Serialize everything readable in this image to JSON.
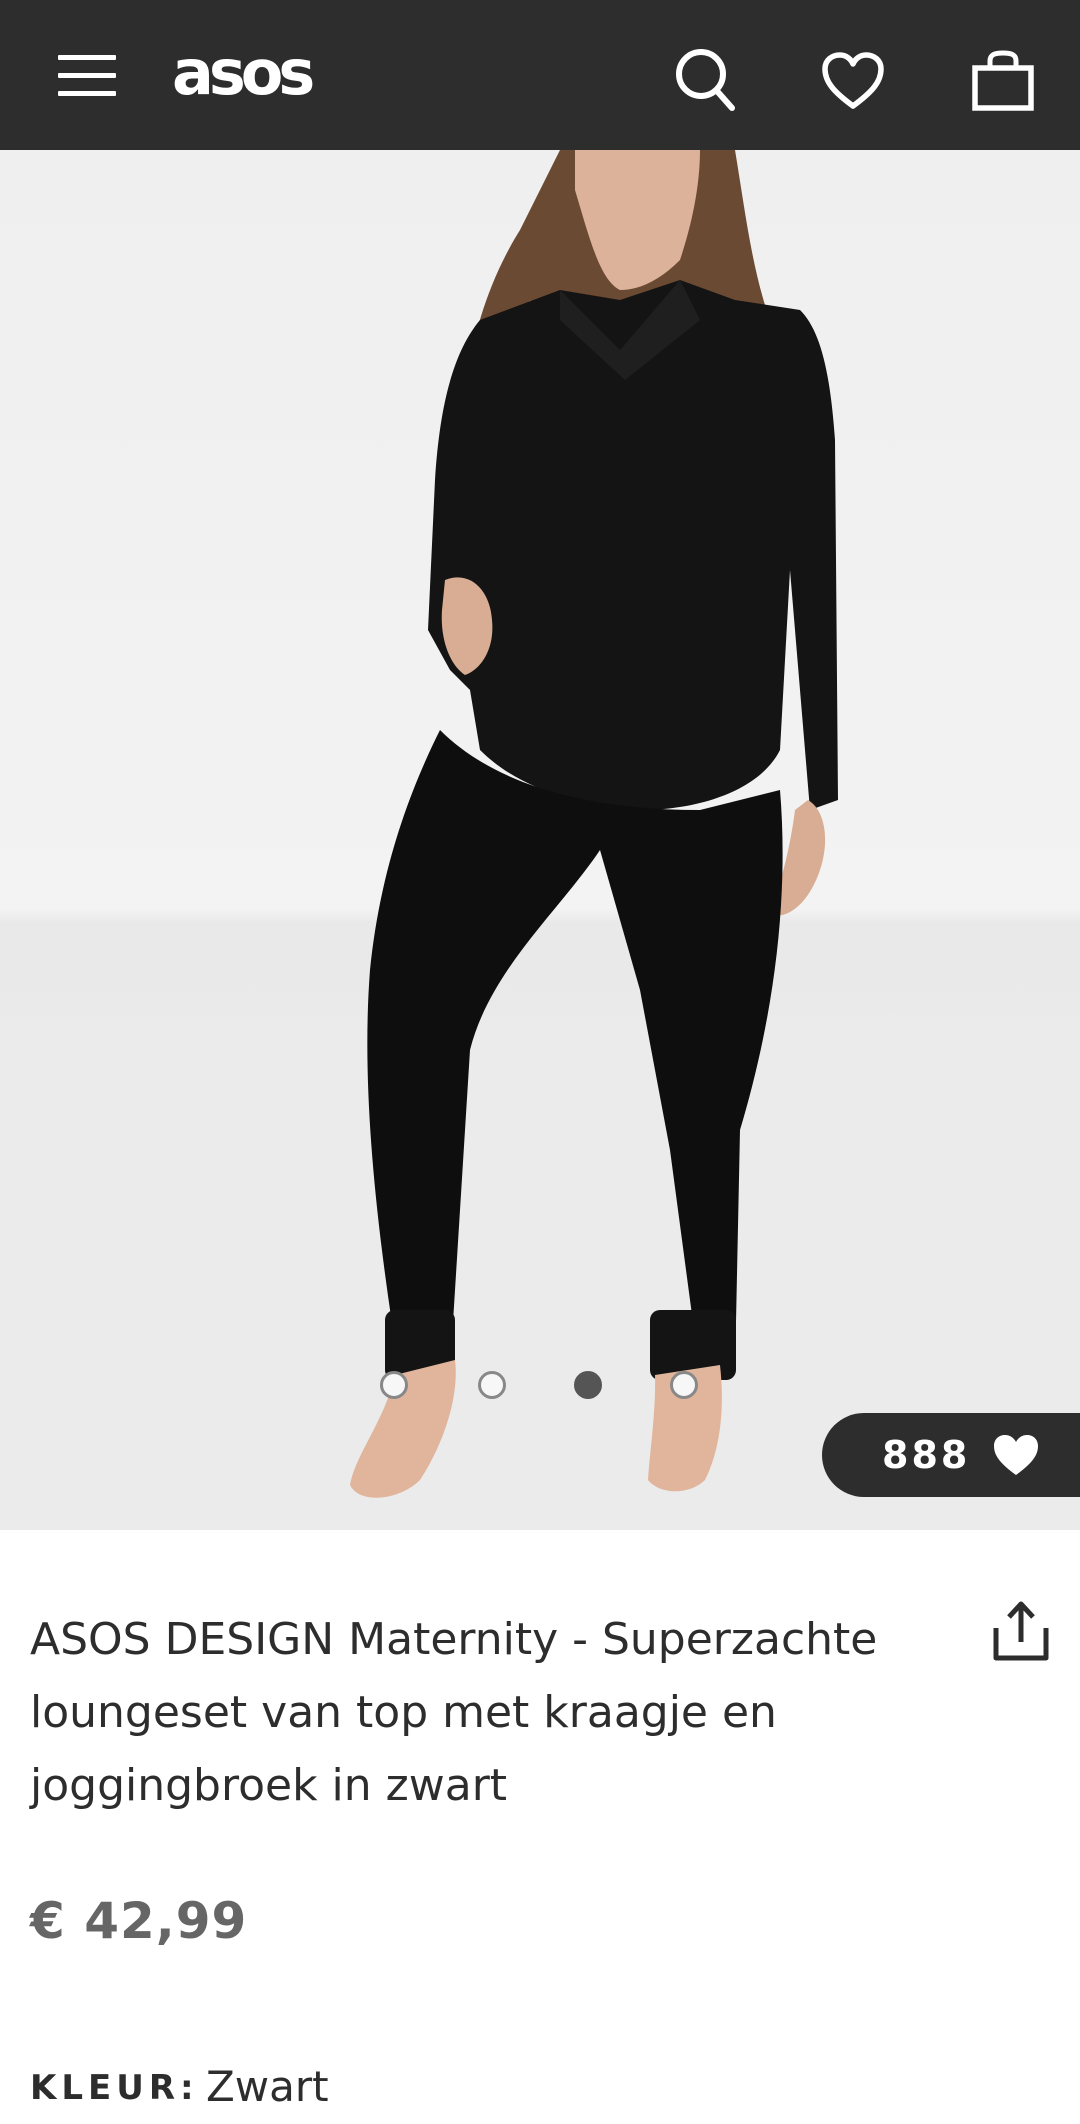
{
  "header": {
    "logo": "asos",
    "menu_icon": "hamburger-menu-icon",
    "search_icon": "search-icon",
    "wishlist_icon": "heart-icon",
    "bag_icon": "shopping-bag-icon",
    "background": "#2d2d2d"
  },
  "gallery": {
    "dots": [
      "empty",
      "empty",
      "active",
      "empty"
    ],
    "saves_count": "888",
    "saves_icon": "heart-icon"
  },
  "product": {
    "title": "ASOS DESIGN Maternity - Superzachte loungeset van top met kraagje en joggingbroek in zwart",
    "price": "€ 42,99",
    "color_label": "KLEUR:",
    "color_value": "Zwart",
    "share_icon": "share-icon"
  }
}
